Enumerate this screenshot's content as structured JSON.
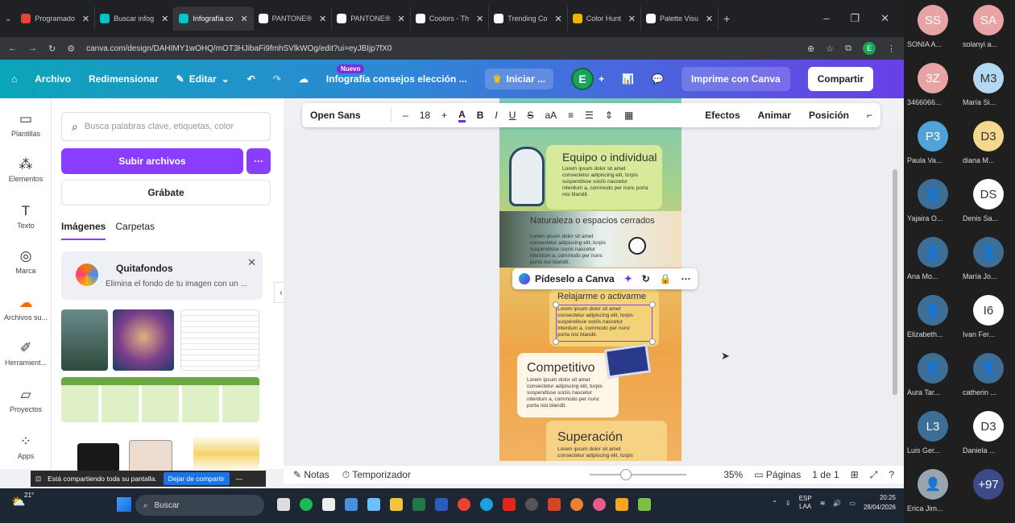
{
  "browser": {
    "tabs": [
      {
        "label": "Programado",
        "color": "#ea4335"
      },
      {
        "label": "Buscar infog",
        "color": "#00c4cc"
      },
      {
        "label": "Infografía co",
        "color": "#00c4cc",
        "active": true
      },
      {
        "label": "PANTONE®",
        "color": "#ffffff"
      },
      {
        "label": "PANTONE®",
        "color": "#ffffff"
      },
      {
        "label": "Coolors - Th",
        "color": "#ffffff"
      },
      {
        "label": "Trending Co",
        "color": "#ffffff"
      },
      {
        "label": "Color Hunt",
        "color": "#f4b400"
      },
      {
        "label": "Palette Visu",
        "color": "#ffffff"
      }
    ],
    "url": "canva.com/design/DAHIMY1wOHQ/mOT3HJibaFi9fmhSVlkWOg/edit?ui=eyJBIjp7fX0",
    "profile_letter": "E"
  },
  "canva_header": {
    "archivo": "Archivo",
    "redimensionar": "Redimensionar",
    "editar": "Editar",
    "nuevo": "Nuevo",
    "doc_title": "Infografía consejos elección ...",
    "iniciar": "Iniciar ...",
    "user_letter": "E",
    "imprime": "Imprime con Canva",
    "compartir": "Compartir"
  },
  "rail": [
    "Plantillas",
    "Elementos",
    "Texto",
    "Marca",
    "Archivos su...",
    "Herramient...",
    "Proyectos",
    "Apps"
  ],
  "panel": {
    "search_placeholder": "Busca palabras clave, etiquetas, color",
    "subir": "Subir archivos",
    "more": "···",
    "grabate": "Grábate",
    "tabs": [
      "Imágenes",
      "Carpetas"
    ],
    "quitafondos_title": "Quitafondos",
    "quitafondos_desc": "Elimina el fondo de tu imagen con un ..."
  },
  "text_toolbar": {
    "font": "Open Sans",
    "size": "18",
    "efectos": "Efectos",
    "animar": "Animar",
    "posicion": "Posición"
  },
  "design": {
    "cards": [
      {
        "title": "Equipo o individual",
        "lorem": "Lorem ipsum dolor sit amet consectetur adipiscing elit, turpis suspendisse sociis nascetur interdum a, commodo per nunc porta nisi blandit."
      },
      {
        "title": "Naturaleza o espacios cerrados",
        "lorem": "Lorem ipsum dolor sit amet consectetur adipiscing elit, turpis suspendisse sociis nascetur interdum a, commodo per nunc porta nisi blandit."
      },
      {
        "title": "Relajarme o activarme",
        "lorem": "Lorem ipsum dolor sit amet consectetur adipiscing elit, turpis suspendisse sociis nascetur interdum a, commodo per nunc porta nisi blandit."
      },
      {
        "title": "Competitivo",
        "lorem": "Lorem ipsum dolor sit amet consectetur adipiscing elit, turpis suspendisse sociis nascetur interdum a, commodo per nunc porta nisi blandit."
      },
      {
        "title": "Superación",
        "lorem": "Lorem ipsum dolor sit amet consectetur adipiscing elit, turpis"
      }
    ],
    "pideselo": "Pídeselo a Canva"
  },
  "bottom": {
    "notas": "Notas",
    "temporizador": "Temporizador",
    "zoom": "35%",
    "paginas": "Páginas",
    "page_count": "1 de 1"
  },
  "share_banner": {
    "text": "Está compartiendo toda su pantalla.",
    "stop": "Dejar de compartir"
  },
  "taskbar": {
    "temp": "21°",
    "search": "Buscar",
    "lang1": "ESP",
    "lang2": "LAA",
    "time": "20:25",
    "date": "28/04/2026"
  },
  "participants": [
    {
      "initials": "SS",
      "name": "SONIA A...",
      "color": "#e8a4a4"
    },
    {
      "initials": "SA",
      "name": "solanyi a...",
      "color": "#e8a4a4"
    },
    {
      "initials": "3Z",
      "name": "3466066...",
      "color": "#e8a4a4"
    },
    {
      "initials": "M3",
      "name": "María Si...",
      "color": "#b4d8f0"
    },
    {
      "initials": "P3",
      "name": "Paula Va...",
      "color": "#4fa3d9"
    },
    {
      "initials": "D3",
      "name": "diana M...",
      "color": "#f5d78e"
    },
    {
      "initials": "",
      "name": "Yajaira O...",
      "color": "#3c6e96"
    },
    {
      "initials": "DS",
      "name": "Denis Sa...",
      "color": "#ffffff"
    },
    {
      "initials": "",
      "name": "Ana Mo...",
      "color": "#3c6e96"
    },
    {
      "initials": "",
      "name": "María Jo...",
      "color": "#3c6e96"
    },
    {
      "initials": "",
      "name": "Elizabeth...",
      "color": "#3c6e96"
    },
    {
      "initials": "I6",
      "name": "Ivan Fer...",
      "color": "#ffffff"
    },
    {
      "initials": "",
      "name": "Aura Tar...",
      "color": "#3c6e96"
    },
    {
      "initials": "",
      "name": "catherin ...",
      "color": "#3c6e96"
    },
    {
      "initials": "L3",
      "name": "Luis Ger...",
      "color": "#3c6e96"
    },
    {
      "initials": "D3",
      "name": "Daniela ...",
      "color": "#ffffff"
    },
    {
      "initials": "",
      "name": "Erica Jim...",
      "color": "#9aa4ae"
    },
    {
      "initials": "+97",
      "name": "",
      "color": "#3c4a8a"
    }
  ]
}
